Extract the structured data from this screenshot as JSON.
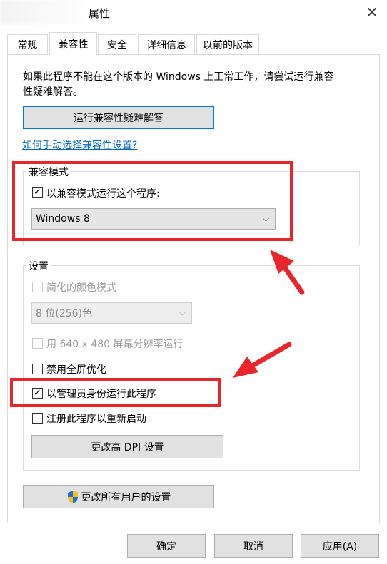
{
  "window": {
    "title": "属性",
    "close_glyph": "✕"
  },
  "tabs": [
    {
      "label": "常规",
      "active": false
    },
    {
      "label": "兼容性",
      "active": true
    },
    {
      "label": "安全",
      "active": false
    },
    {
      "label": "详细信息",
      "active": false
    },
    {
      "label": "以前的版本",
      "active": false
    }
  ],
  "compat": {
    "intro_line1": "如果此程序不能在这个版本的 Windows 上正常工作，请尝试运行兼容",
    "intro_line2": "性疑难解答。",
    "troubleshoot_button": "运行兼容性疑难解答",
    "manual_link": "如何手动选择兼容性设置?",
    "mode_group_label": "兼容模式",
    "mode_checkbox_label": "以兼容模式运行这个程序:",
    "mode_checkbox_checked": true,
    "os_select_value": "Windows 8"
  },
  "settings": {
    "group_label": "设置",
    "reduced_color_label": "简化的颜色模式",
    "reduced_color_checked": false,
    "color_select_value": "8 位(256)色",
    "res_640_label": "用 640 x 480 屏幕分辨率运行",
    "res_640_checked": false,
    "disable_fullscreen_label": "禁用全屏优化",
    "disable_fullscreen_checked": false,
    "run_as_admin_label": "以管理员身份运行此程序",
    "run_as_admin_checked": true,
    "register_restart_label": "注册此程序以重新启动",
    "register_restart_checked": false,
    "dpi_button": "更改高 DPI 设置"
  },
  "all_users_button": "更改所有用户的设置",
  "footer": {
    "ok": "确定",
    "cancel": "取消",
    "apply": "应用(A)"
  },
  "colors": {
    "annotation_red": "#e8262c",
    "link_blue": "#0066cc",
    "focus_blue": "#0078d7"
  },
  "icons": {
    "check": "✓",
    "chevron": "⌵",
    "shield": "uac-shield-icon"
  }
}
